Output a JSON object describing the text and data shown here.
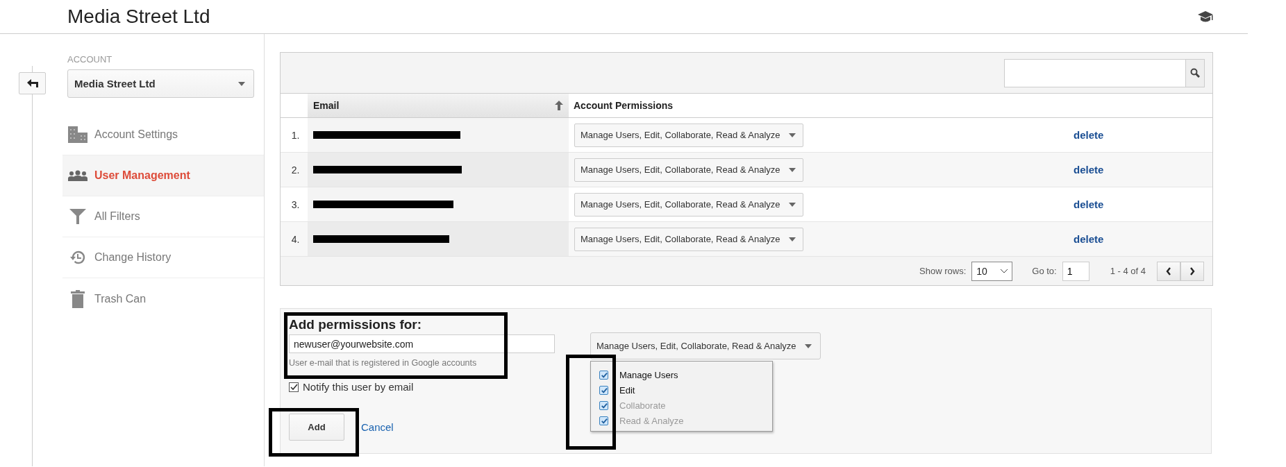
{
  "header": {
    "title": "Media Street Ltd"
  },
  "sidebar": {
    "section_label": "ACCOUNT",
    "account": "Media Street Ltd",
    "items": [
      {
        "label": "Account Settings",
        "kind": "building",
        "selected": false
      },
      {
        "label": "User Management",
        "kind": "people",
        "selected": true
      },
      {
        "label": "All Filters",
        "kind": "filter",
        "selected": false
      },
      {
        "label": "Change History",
        "kind": "history",
        "selected": false
      },
      {
        "label": "Trash Can",
        "kind": "trash",
        "selected": false
      }
    ]
  },
  "table": {
    "columns": [
      "Email",
      "Account Permissions"
    ],
    "rows": [
      {
        "number": "1.",
        "permissions": "Manage Users, Edit, Collaborate, Read & Analyze",
        "action": "delete"
      },
      {
        "number": "2.",
        "permissions": "Manage Users, Edit, Collaborate, Read & Analyze",
        "action": "delete"
      },
      {
        "number": "3.",
        "permissions": "Manage Users, Edit, Collaborate, Read & Analyze",
        "action": "delete"
      },
      {
        "number": "4.",
        "permissions": "Manage Users, Edit, Collaborate, Read & Analyze",
        "action": "delete"
      }
    ],
    "footer": {
      "show_rows_label": "Show rows:",
      "show_rows": "10",
      "goto_label": "Go to:",
      "goto": "1",
      "range": "1 - 4 of 4"
    }
  },
  "add_permissions": {
    "title": "Add permissions for:",
    "email": "newuser@yourwebsite.com",
    "hint": "User e-mail that is registered in Google accounts",
    "notify": {
      "label": "Notify this user by email",
      "checked": true
    },
    "permissions": "Manage Users, Edit, Collaborate, Read & Analyze",
    "options": [
      {
        "label": "Manage Users",
        "checked": true,
        "disabled": false
      },
      {
        "label": "Edit",
        "checked": true,
        "disabled": false
      },
      {
        "label": "Collaborate",
        "checked": true,
        "disabled": true
      },
      {
        "label": "Read & Analyze",
        "checked": true,
        "disabled": true
      }
    ],
    "add_button": "Add",
    "cancel_link": "Cancel"
  }
}
